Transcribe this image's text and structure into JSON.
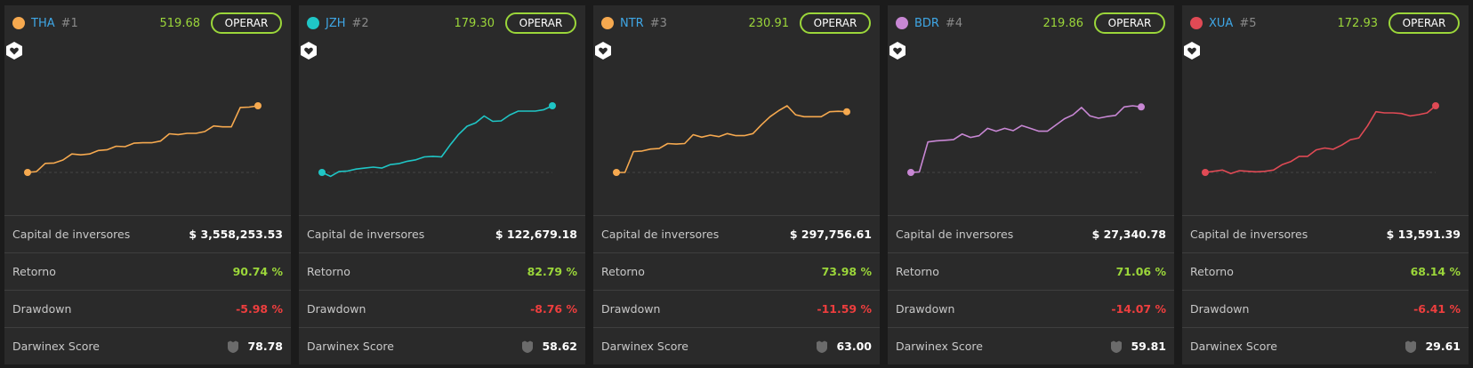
{
  "labels": {
    "investor_capital": "Capital de inversores",
    "return": "Retorno",
    "drawdown": "Drawdown",
    "score": "Darwinex Score"
  },
  "cards": [
    {
      "ticker": "THA",
      "rank": "#1",
      "price": "519.68",
      "button": "OPERAR",
      "color": "#f6a94f",
      "capital": "$ 3,558,253.53",
      "return": "90.74 %",
      "drawdown": "-5.98 %",
      "score": "78.78",
      "series": [
        0,
        0.2,
        2.1,
        2.2,
        2.9,
        4.3,
        4.1,
        4.3,
        5.1,
        5.3,
        6.1,
        6.0,
        6.8,
        6.9,
        6.9,
        7.3,
        9.0,
        8.8,
        9.1,
        9.1,
        9.5,
        10.8,
        10.6,
        10.6,
        15.1,
        15.2,
        15.5
      ]
    },
    {
      "ticker": "JZH",
      "rank": "#2",
      "price": "179.30",
      "button": "OPERAR",
      "color": "#1fc6c6",
      "capital": "$ 122,679.18",
      "return": "82.79 %",
      "drawdown": "-8.76 %",
      "score": "58.62",
      "series": [
        0,
        -0.8,
        0.2,
        0.3,
        0.7,
        0.9,
        1.1,
        0.9,
        1.6,
        1.8,
        2.3,
        2.6,
        3.2,
        3.3,
        3.2,
        5.6,
        7.8,
        9.5,
        10.2,
        11.6,
        10.5,
        10.6,
        11.8,
        12.6,
        12.6,
        12.6,
        12.9,
        13.7
      ]
    },
    {
      "ticker": "NTR",
      "rank": "#3",
      "price": "230.91",
      "button": "OPERAR",
      "color": "#f6a94f",
      "capital": "$ 297,756.61",
      "return": "73.98 %",
      "drawdown": "-11.59 %",
      "score": "63.00",
      "series": [
        0,
        0,
        4.2,
        4.3,
        4.7,
        4.8,
        5.8,
        5.7,
        5.8,
        7.6,
        7.1,
        7.5,
        7.2,
        7.8,
        7.4,
        7.4,
        7.8,
        9.6,
        11.2,
        12.4,
        13.4,
        11.6,
        11.2,
        11.2,
        11.2,
        12.2,
        12.3,
        12.2
      ]
    },
    {
      "ticker": "BDR",
      "rank": "#4",
      "price": "219.86",
      "button": "OPERAR",
      "color": "#c887d4",
      "capital": "$ 27,340.78",
      "return": "71.06 %",
      "drawdown": "-14.07 %",
      "score": "59.81",
      "series": [
        0,
        0.1,
        5.4,
        5.6,
        5.7,
        5.8,
        6.8,
        6.2,
        6.5,
        7.8,
        7.3,
        7.8,
        7.4,
        8.3,
        7.8,
        7.3,
        7.3,
        8.4,
        9.5,
        10.2,
        11.5,
        10.0,
        9.6,
        9.9,
        10.1,
        11.6,
        11.8,
        11.6
      ]
    },
    {
      "ticker": "XUA",
      "rank": "#5",
      "price": "172.93",
      "button": "OPERAR",
      "color": "#e04a55",
      "capital": "$ 13,591.39",
      "return": "68.14 %",
      "drawdown": "-6.41 %",
      "score": "29.61",
      "series": [
        0,
        0.2,
        0.4,
        -0.2,
        0.3,
        0.2,
        0.1,
        0.2,
        0.4,
        1.3,
        1.8,
        2.7,
        2.7,
        3.8,
        4.1,
        3.9,
        4.6,
        5.5,
        5.8,
        7.8,
        10.2,
        10.0,
        10.0,
        9.9,
        9.5,
        9.7,
        10.0,
        11.2
      ]
    }
  ]
}
